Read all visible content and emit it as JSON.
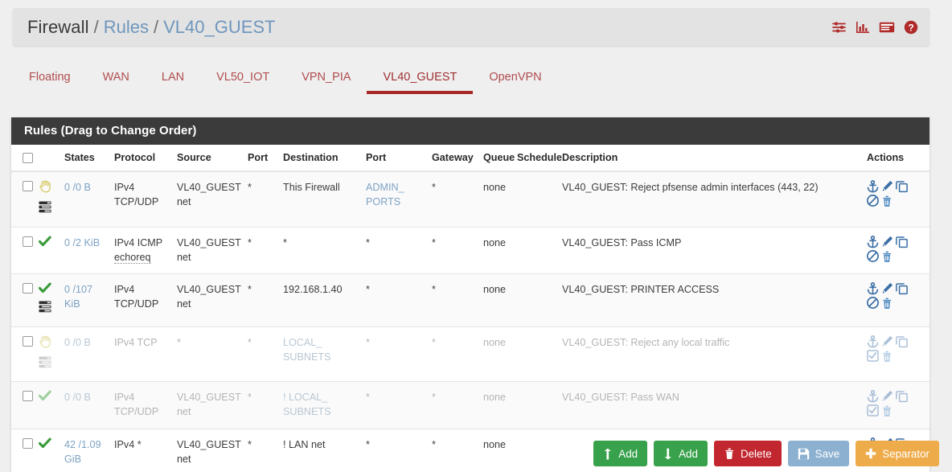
{
  "breadcrumb": {
    "root": "Firewall",
    "sep": "/",
    "section": "Rules",
    "current": "VL40_GUEST",
    "icons": [
      {
        "name": "sliders-icon"
      },
      {
        "name": "bar-chart-icon"
      },
      {
        "name": "table-list-icon"
      },
      {
        "name": "help-circle-icon"
      }
    ]
  },
  "tabs": [
    {
      "label": "Floating",
      "active": false
    },
    {
      "label": "WAN",
      "active": false
    },
    {
      "label": "LAN",
      "active": false
    },
    {
      "label": "VL50_IOT",
      "active": false
    },
    {
      "label": "VPN_PIA",
      "active": false
    },
    {
      "label": "VL40_GUEST",
      "active": true
    },
    {
      "label": "OpenVPN",
      "active": false
    }
  ],
  "panel": {
    "title": "Rules (Drag to Change Order)",
    "columns": [
      "",
      "",
      "States",
      "Protocol",
      "Source",
      "Port",
      "Destination",
      "Port",
      "Gateway",
      "Queue",
      "Schedule",
      "Description",
      "Actions"
    ]
  },
  "rows": [
    {
      "action_icon": "reject-hand-icon",
      "logged": true,
      "disabled": false,
      "states": "0 /0 B",
      "protocol": "IPv4 TCP/UDP",
      "protocol_note": "",
      "source": "VL40_GUEST net",
      "source_port": "*",
      "destination": "This Firewall",
      "destination_link": false,
      "dest_port": "ADMIN_ PORTS",
      "dest_port_link": true,
      "gateway": "*",
      "queue": "none",
      "schedule": "",
      "description": "VL40_GUEST: Reject pfsense admin interfaces (443, 22)",
      "toggle_icon": "ban-circle-icon"
    },
    {
      "action_icon": "pass-check-icon",
      "logged": false,
      "disabled": false,
      "states": "0 /2 KiB",
      "protocol": "IPv4 ICMP",
      "protocol_note": "echoreq",
      "source": "VL40_GUEST net",
      "source_port": "*",
      "destination": "*",
      "destination_link": false,
      "dest_port": "*",
      "dest_port_link": false,
      "gateway": "*",
      "queue": "none",
      "schedule": "",
      "description": "VL40_GUEST: Pass ICMP",
      "toggle_icon": "ban-circle-icon"
    },
    {
      "action_icon": "pass-check-icon",
      "logged": true,
      "disabled": false,
      "states": "0 /107 KiB",
      "protocol": "IPv4 TCP/UDP",
      "protocol_note": "",
      "source": "VL40_GUEST net",
      "source_port": "*",
      "destination": "192.168.1.40",
      "destination_link": false,
      "dest_port": "*",
      "dest_port_link": false,
      "gateway": "*",
      "queue": "none",
      "schedule": "",
      "description": "VL40_GUEST: PRINTER ACCESS",
      "toggle_icon": "ban-circle-icon"
    },
    {
      "action_icon": "reject-hand-icon",
      "logged": true,
      "disabled": true,
      "states": "0 /0 B",
      "protocol": "IPv4 TCP",
      "protocol_note": "",
      "source": "*",
      "source_port": "*",
      "destination": "LOCAL_ SUBNETS",
      "destination_link": true,
      "dest_port": "*",
      "dest_port_link": false,
      "gateway": "*",
      "queue": "none",
      "schedule": "",
      "description": "VL40_GUEST: Reject any local traffic",
      "toggle_icon": "check-square-icon"
    },
    {
      "action_icon": "pass-check-icon",
      "logged": false,
      "disabled": true,
      "states": "0 /0 B",
      "protocol": "IPv4 TCP/UDP",
      "protocol_note": "",
      "source": "VL40_GUEST net",
      "source_port": "*",
      "destination": "! LOCAL_ SUBNETS",
      "destination_link": true,
      "dest_port": "*",
      "dest_port_link": false,
      "gateway": "*",
      "queue": "none",
      "schedule": "",
      "description": "VL40_GUEST: Pass WAN",
      "toggle_icon": "check-square-icon"
    },
    {
      "action_icon": "pass-check-icon",
      "logged": false,
      "disabled": false,
      "states": "42 /1.09 GiB",
      "protocol": "IPv4 *",
      "protocol_note": "",
      "source": "VL40_GUEST net",
      "source_port": "*",
      "destination": "! LAN net",
      "destination_link": false,
      "dest_port": "*",
      "dest_port_link": false,
      "gateway": "*",
      "queue": "none",
      "schedule": "",
      "description": "",
      "toggle_icon": "ban-circle-icon"
    }
  ],
  "row_actions": {
    "anchor": "anchor-icon",
    "edit": "pencil-icon",
    "copy": "copy-icon",
    "delete": "trash-icon"
  },
  "footer_buttons": [
    {
      "label": "Add",
      "icon": "arrow-up-icon",
      "style": "btn-green"
    },
    {
      "label": "Add",
      "icon": "arrow-down-icon",
      "style": "btn-green"
    },
    {
      "label": "Delete",
      "icon": "trash-icon",
      "style": "btn-red"
    },
    {
      "label": "Save",
      "icon": "floppy-icon",
      "style": "btn-blue"
    },
    {
      "label": "Separator",
      "icon": "plus-icon",
      "style": "btn-orange"
    }
  ],
  "colors": {
    "accent_red": "#a82828",
    "tab_red": "#b04c4c",
    "link_blue": "#7da2c4",
    "header_dark": "#3b3b3b",
    "pass_green": "#3a9b3a",
    "reject_gold": "#d8cb6a",
    "action_blue": "#3a6ea5"
  }
}
